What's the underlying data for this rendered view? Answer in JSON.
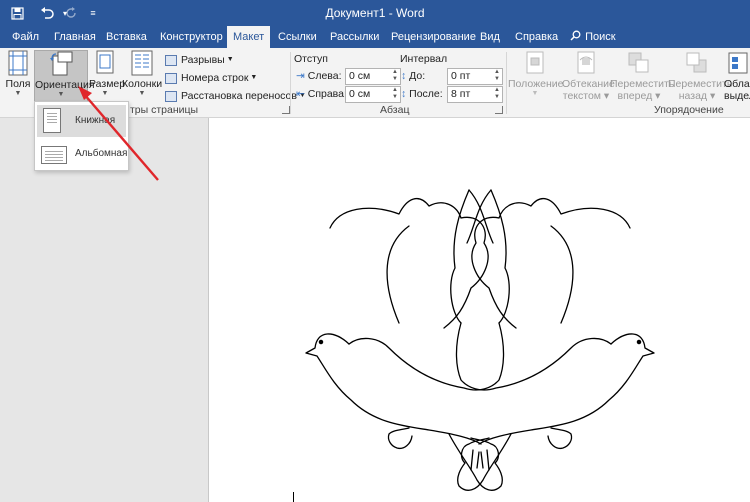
{
  "window": {
    "title": "Документ1  -  Word"
  },
  "tabs": [
    "Файл",
    "Главная",
    "Вставка",
    "Конструктор",
    "Макет",
    "Ссылки",
    "Рассылки",
    "Рецензирование",
    "Вид",
    "Справка"
  ],
  "search_label": "Поиск",
  "ribbon": {
    "page_setup": {
      "margins": "Поля",
      "orientation": "Ориентация",
      "size": "Размер",
      "columns": "Колонки",
      "breaks": "Разрывы",
      "line_numbers": "Номера строк",
      "hyphenation": "Расстановка переносов",
      "group_label": "тры страницы"
    },
    "paragraph": {
      "indent_label": "Отступ",
      "left_label": "Слева:",
      "left_value": "0 см",
      "right_label": "Справа:",
      "right_value": "0 см",
      "spacing_label": "Интервал",
      "before_label": "До:",
      "before_value": "0 пт",
      "after_label": "После:",
      "after_value": "8 пт",
      "group_label": "Абзац"
    },
    "arrange": {
      "position": "Положение",
      "wrap_text_1": "Обтекание",
      "wrap_text_2": "текстом",
      "bring_forward_1": "Переместить",
      "bring_forward_2": "вперед",
      "send_backward_1": "Переместить",
      "send_backward_2": "назад",
      "selection_1": "Обла",
      "selection_2": "выдел",
      "group_label": "Упорядочение"
    }
  },
  "orientation_menu": {
    "portrait": "Книжная",
    "landscape": "Альбомная"
  },
  "colors": {
    "accent": "#2b579a",
    "arrow": "#e0262b"
  }
}
